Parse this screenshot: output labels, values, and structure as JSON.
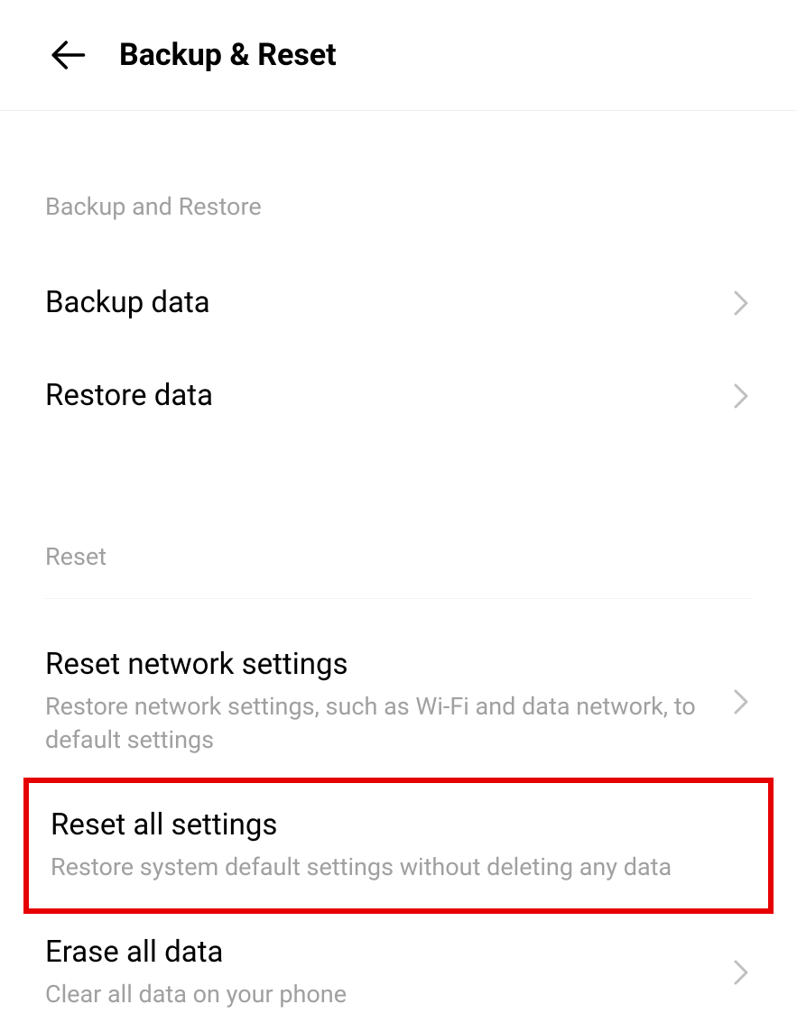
{
  "header": {
    "title": "Backup & Reset"
  },
  "sections": {
    "backup": {
      "header": "Backup and Restore",
      "items": [
        {
          "title": "Backup data"
        },
        {
          "title": "Restore data"
        }
      ]
    },
    "reset": {
      "header": "Reset",
      "items": [
        {
          "title": "Reset network settings",
          "subtitle": "Restore network settings, such as Wi-Fi and data network, to default settings"
        },
        {
          "title": "Reset all settings",
          "subtitle": "Restore system default settings without deleting any data"
        },
        {
          "title": "Erase all data",
          "subtitle": "Clear all data on your phone"
        }
      ]
    }
  }
}
